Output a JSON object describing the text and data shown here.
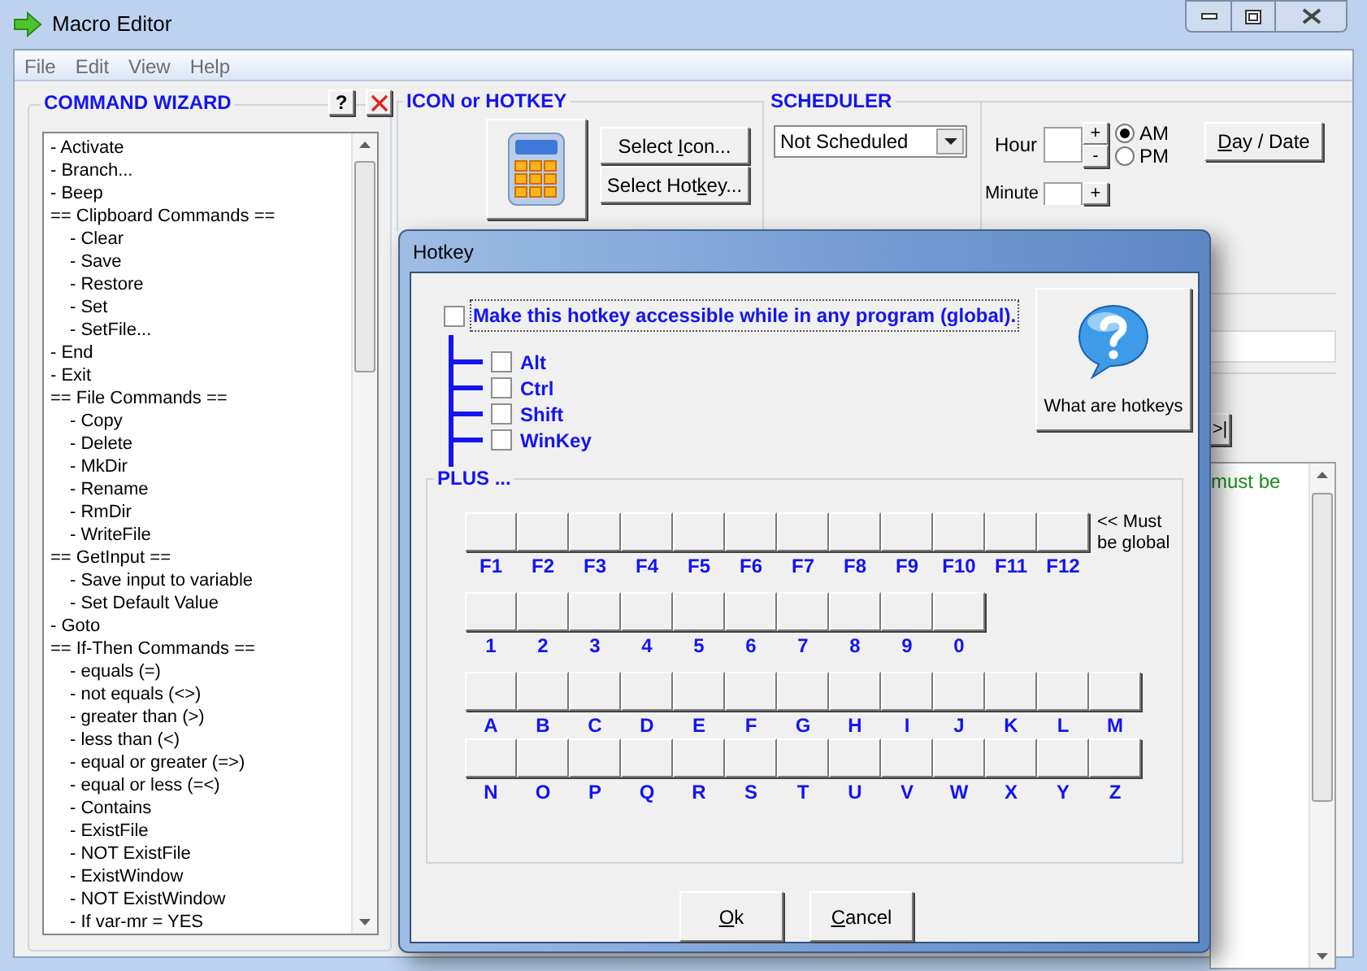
{
  "window": {
    "title": "Macro Editor"
  },
  "menu": [
    "File",
    "Edit",
    "View",
    "Help"
  ],
  "command_wizard": {
    "title": "COMMAND WIZARD",
    "help_button": "?",
    "items": [
      {
        "text": "- Activate"
      },
      {
        "text": "- Branch..."
      },
      {
        "text": "- Beep"
      },
      {
        "text": "== Clipboard Commands ==",
        "children": [
          {
            "text": "- Clear"
          },
          {
            "text": "- Save"
          },
          {
            "text": "- Restore"
          },
          {
            "text": "- Set"
          },
          {
            "text": "- SetFile..."
          }
        ]
      },
      {
        "text": "- End"
      },
      {
        "text": "- Exit"
      },
      {
        "text": "== File Commands ==",
        "children": [
          {
            "text": "- Copy"
          },
          {
            "text": "- Delete"
          },
          {
            "text": "- MkDir"
          },
          {
            "text": "- Rename"
          },
          {
            "text": "- RmDir"
          },
          {
            "text": "- WriteFile"
          }
        ]
      },
      {
        "text": "== GetInput ==",
        "children": [
          {
            "text": "- Save input to variable"
          },
          {
            "text": "- Set Default Value"
          }
        ]
      },
      {
        "text": "- Goto"
      },
      {
        "text": "== If-Then Commands ==",
        "children": [
          {
            "text": "- equals (=)"
          },
          {
            "text": "- not equals (<>)"
          },
          {
            "text": "- greater than (>)"
          },
          {
            "text": "- less than (<)"
          },
          {
            "text": "- equal or greater (=>)"
          },
          {
            "text": "- equal or less (=<)"
          },
          {
            "text": "- Contains"
          },
          {
            "text": "- ExistFile"
          },
          {
            "text": "- NOT ExistFile"
          },
          {
            "text": "- ExistWindow"
          },
          {
            "text": "- NOT ExistWindow"
          },
          {
            "text": "- If var-mr = YES"
          }
        ]
      }
    ]
  },
  "icon_hotkey": {
    "title": "ICON or HOTKEY",
    "buttons": [
      {
        "before": "Select ",
        "key": "I",
        "after": "con..."
      },
      {
        "before": "Select Hot",
        "key": "k",
        "after": "ey..."
      }
    ]
  },
  "scheduler": {
    "title": "SCHEDULER",
    "select": "Not Scheduled",
    "hour_label": "Hour",
    "minute_label": "Minute",
    "plus": "+",
    "minus": "-",
    "radios": [
      {
        "label": "AM",
        "selected": true
      },
      {
        "label": "PM",
        "selected": false
      }
    ],
    "day_button": {
      "key": "D",
      "after": "ay / Date"
    }
  },
  "editor": {
    "end_button": ">|",
    "text": "must be"
  },
  "dialog": {
    "title": "Hotkey",
    "global": {
      "label": "Make this hotkey accessible while in any program (global).",
      "checked": false
    },
    "modifiers": [
      {
        "label": "Alt",
        "checked": false
      },
      {
        "label": "Ctrl",
        "checked": false
      },
      {
        "label": "Shift",
        "checked": false
      },
      {
        "label": "WinKey",
        "checked": false
      }
    ],
    "help_button": "What are hotkeys",
    "plus_title": "PLUS ...",
    "key_rows": [
      {
        "keys": [
          "F1",
          "F2",
          "F3",
          "F4",
          "F5",
          "F6",
          "F7",
          "F8",
          "F9",
          "F10",
          "F11",
          "F12"
        ],
        "note": "<< Must be global"
      },
      {
        "keys": [
          "1",
          "2",
          "3",
          "4",
          "5",
          "6",
          "7",
          "8",
          "9",
          "0"
        ]
      },
      {
        "keys": [
          "A",
          "B",
          "C",
          "D",
          "E",
          "F",
          "G",
          "H",
          "I",
          "J",
          "K",
          "L",
          "M"
        ]
      },
      {
        "keys": [
          "N",
          "O",
          "P",
          "Q",
          "R",
          "S",
          "T",
          "U",
          "V",
          "W",
          "X",
          "Y",
          "Z"
        ]
      }
    ],
    "buttons": [
      {
        "key": "O",
        "after": "k"
      },
      {
        "key": "C",
        "after": "ancel"
      }
    ]
  }
}
